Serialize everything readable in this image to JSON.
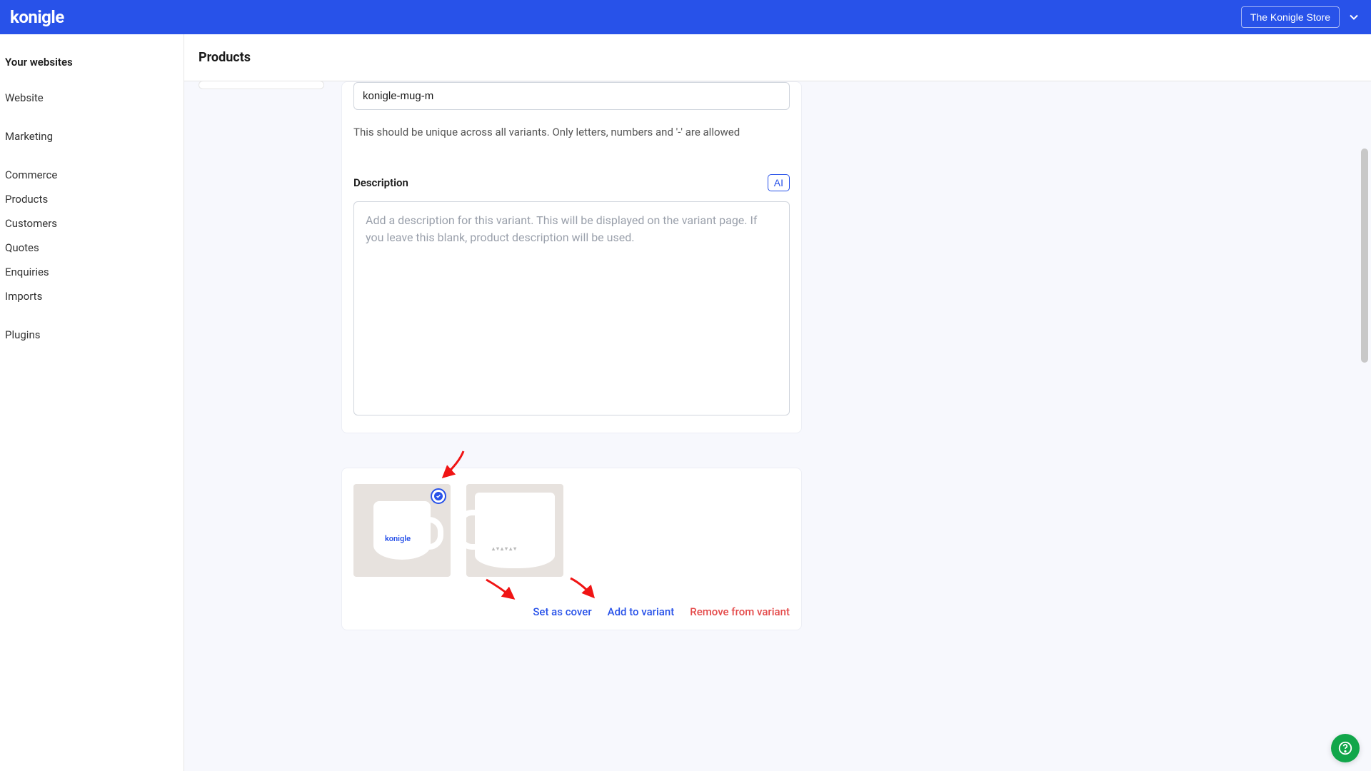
{
  "header": {
    "logo_text": "konigle",
    "store_button": "The Konigle Store"
  },
  "sidebar": {
    "heading": "Your websites",
    "website_label": "Website",
    "marketing_label": "Marketing",
    "commerce_label": "Commerce",
    "commerce_items": [
      "Products",
      "Customers",
      "Quotes",
      "Enquiries",
      "Imports"
    ],
    "plugins_label": "Plugins"
  },
  "main": {
    "title": "Products",
    "sku_value": "konigle-mug-m",
    "sku_helper": "This should be unique across all variants. Only letters, numbers and '-' are allowed",
    "description_label": "Description",
    "ai_button": "AI",
    "description_placeholder": "Add a description for this variant. This will be displayed on the variant page. If you leave this blank, product description will be used."
  },
  "images": {
    "thumb1_label": "konigle",
    "thumb2_label": "▴▾▴▾▴▾",
    "action_cover": "Set as cover",
    "action_add": "Add to variant",
    "action_remove": "Remove from variant"
  }
}
